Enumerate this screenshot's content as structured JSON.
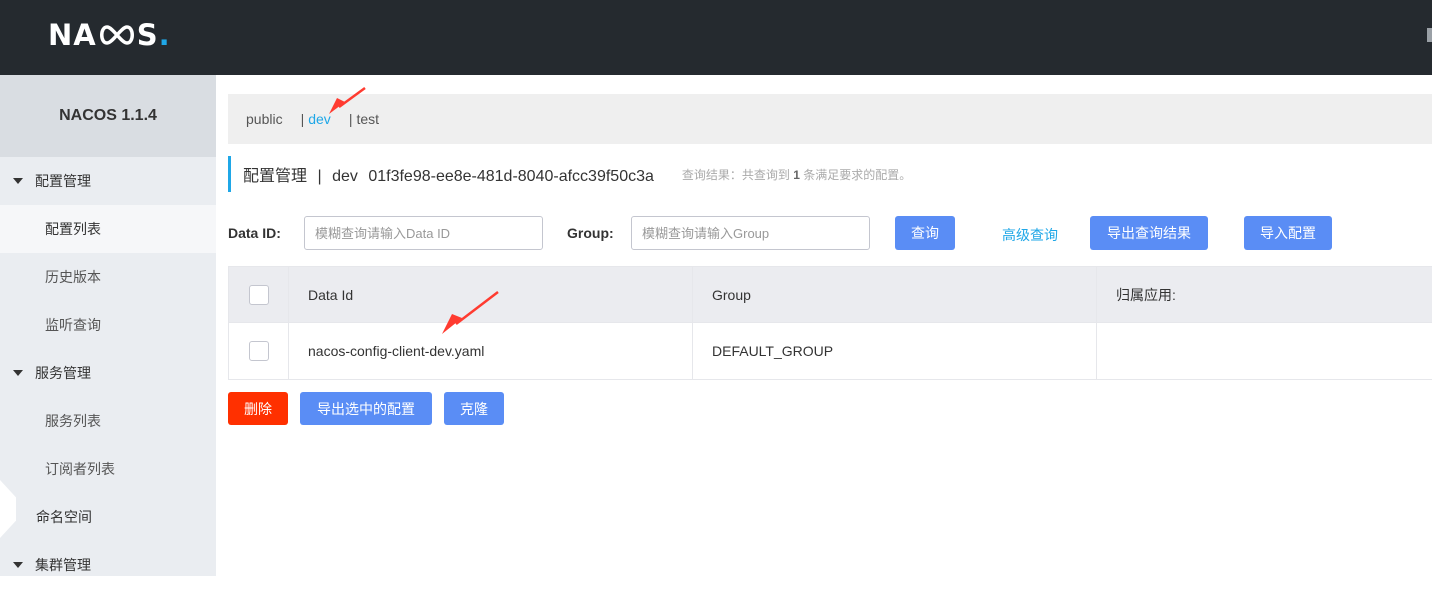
{
  "topbar": {
    "logo_prefix": "NA",
    "logo_suffix": "S",
    "logo_dot": "."
  },
  "sidebar": {
    "version": "NACOS 1.1.4",
    "groups": [
      {
        "label": "配置管理",
        "items": [
          "配置列表",
          "历史版本",
          "监听查询"
        ]
      },
      {
        "label": "服务管理",
        "items": [
          "服务列表",
          "订阅者列表"
        ]
      }
    ],
    "namespace_item": "命名空间",
    "cluster_group": "集群管理"
  },
  "namespaces": {
    "items": [
      "public",
      "dev",
      "test"
    ],
    "active": "dev",
    "separator": "|"
  },
  "title": {
    "section": "配置管理",
    "separator": "|",
    "namespace": "dev",
    "namespace_id": "01f3fe98-ee8e-481d-8040-afcc39f50c3a",
    "tip_prefix": "查询结果：共查询到",
    "tip_count": "1",
    "tip_suffix": "条满足要求的配置。"
  },
  "filters": {
    "data_id_label": "Data ID:",
    "data_id_placeholder": "模糊查询请输入Data ID",
    "group_label": "Group:",
    "group_placeholder": "模糊查询请输入Group",
    "query_button": "查询",
    "advanced_query": "高级查询",
    "export_results": "导出查询结果",
    "import_config": "导入配置"
  },
  "table": {
    "headers": [
      "Data Id",
      "Group",
      "归属应用:"
    ],
    "rows": [
      {
        "data_id": "nacos-config-client-dev.yaml",
        "group": "DEFAULT_GROUP",
        "app": ""
      }
    ]
  },
  "actions": {
    "delete": "删除",
    "export_selected": "导出选中的配置",
    "clone": "克隆"
  },
  "colors": {
    "accent": "#1fa7e7",
    "primary": "#5a8df5",
    "danger": "#ff3000",
    "topbar": "#252a2f"
  }
}
